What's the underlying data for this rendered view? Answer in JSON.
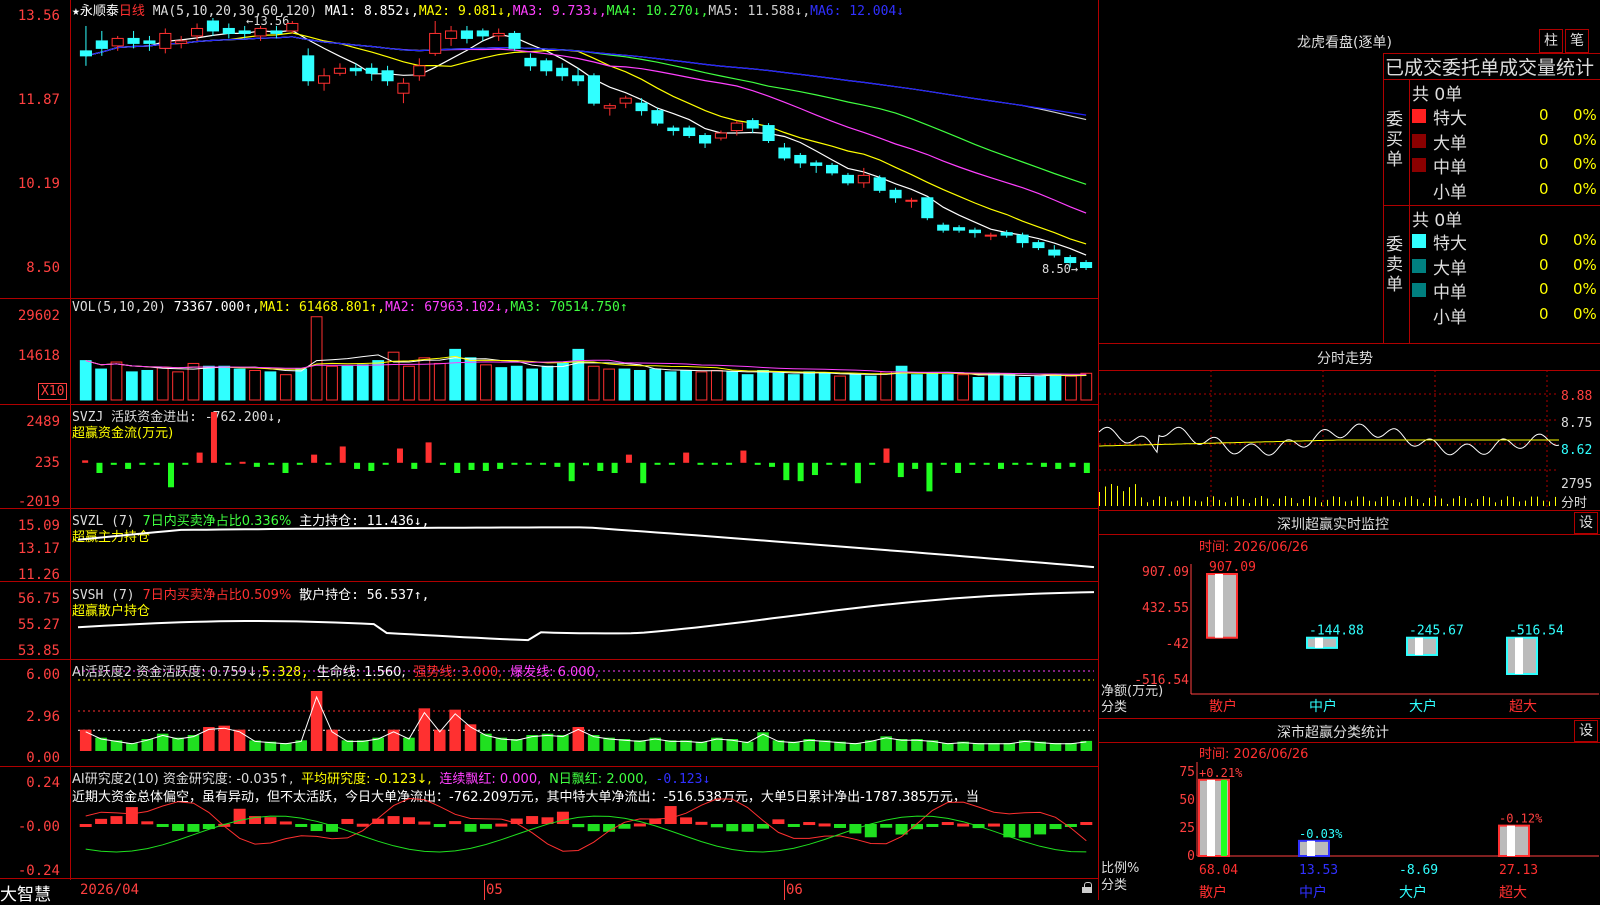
{
  "colors": {
    "up": "#ff3030",
    "down": "#30ffff",
    "ma1": "#ffffff",
    "ma2": "#ffff00",
    "ma3": "#ff40ff",
    "ma4": "#40ff40",
    "ma5": "#d0d0d0",
    "ma6": "#2020ff",
    "grid": "#b00000"
  },
  "price": {
    "stock_name": "永顺泰",
    "period": "日线",
    "params": "MA(5,10,20,30,60,120)",
    "ma1": "MA1: 8.852↓,",
    "ma2": "MA2: 9.081↓,",
    "ma3": "MA3: 9.733↓,",
    "ma4": "MA4: 10.270↓,",
    "ma5": "MA5: 11.588↓,",
    "ma6": "MA6: 12.004↓",
    "high_label": "13.56",
    "low_label": "8.50",
    "axis": [
      "13.56",
      "11.87",
      "10.19",
      "8.50"
    ]
  },
  "vol": {
    "params": "VOL(5,10,20)",
    "value": "73367.000↑,",
    "ma1": "MA1: 61468.801↑,",
    "ma2": "MA2: 67963.102↓,",
    "ma3": "MA3: 70514.750↑",
    "axis": [
      "29602",
      "14618"
    ],
    "unit": "X10"
  },
  "svzj": {
    "title": "SVZJ  活跃资金进出: -762.200↓,",
    "sub": "超赢资金流(万元)",
    "axis": [
      "2489",
      "235",
      "-2019"
    ]
  },
  "svzl": {
    "title_a": "SVZL (7)",
    "title_b": "7日内买卖净占比0.336%",
    "title_c": "主力持仓: 11.436↓,",
    "sub": "超赢主力持仓",
    "axis": [
      "15.09",
      "13.17",
      "11.26"
    ]
  },
  "svsh": {
    "title_a": "SVSH (7)",
    "title_b": "7日内买卖净占比0.509%",
    "title_c": "散户持仓: 56.537↑,",
    "sub": "超赢散户持仓",
    "axis": [
      "56.75",
      "55.27",
      "53.85"
    ]
  },
  "ai1": {
    "t1": "AI活跃度2 资金活跃度: 0.759↓,",
    "t2": "5.328,",
    "t3": "生命线: 1.560,",
    "t4": "强势线: 3.000,",
    "t5": "爆发线: 6.000,",
    "axis": [
      "6.00",
      "2.96",
      "0.00"
    ]
  },
  "ai2": {
    "t1": "AI研究度2(10) 资金研究度: -0.035↑,",
    "t2": "平均研究度: -0.123↓,",
    "t3": "连续飘红: 0.000,",
    "t4": "N日飘红: 2.000,",
    "t5": "-0.123↓",
    "desc": "近期大资金总体偏空，虽有异动，但不太活跃，今日大单净流出：-762.209万元，其中特大单净流出：-516.538万元，大单5日累计净出-1787.385万元，当",
    "axis": [
      "0.24",
      "-0.00",
      "-0.24"
    ]
  },
  "xaxis": {
    "d1": "2026/04",
    "d2": "05",
    "d3": "06"
  },
  "app_logo": "大智慧",
  "right": {
    "title": "龙虎看盘(逐单)",
    "btn_zhu": "柱",
    "btn_bi": "笔",
    "tab_title": "已成交委托单成交量统计",
    "buy_vert": "委买单",
    "sell_vert": "委卖单",
    "buy_total": "共 0单",
    "sell_total": "共 0单",
    "rows": [
      {
        "name": "特大",
        "v": "0",
        "p": "0%"
      },
      {
        "name": "大单",
        "v": "0",
        "p": "0%"
      },
      {
        "name": "中单",
        "v": "0",
        "p": "0%"
      },
      {
        "name": "小单",
        "v": "0",
        "p": "0%"
      }
    ],
    "fenshi": "分时走势",
    "fs_axis": [
      "8.88",
      "8.75",
      "8.62"
    ],
    "fs_vol": "2795",
    "fs_label": "分时",
    "monitor_title": "深圳超赢实时监控",
    "monitor_set": "设",
    "monitor_time": "时间: 2026/06/26",
    "monitor_axis": [
      "907.09",
      "432.55",
      "-42",
      "-516.54"
    ],
    "monitor_ylabel": "净额(万元)",
    "monitor_xlabel": "分类",
    "monitor_bars": [
      {
        "name": "散户",
        "value": 907.09,
        "label": "907.09"
      },
      {
        "name": "中户",
        "value": -144.88,
        "label": "-144.88"
      },
      {
        "name": "大户",
        "value": -245.67,
        "label": "-245.67"
      },
      {
        "name": "超大",
        "value": -516.54,
        "label": "-516.54"
      }
    ],
    "stat_title": "深市超赢分类统计",
    "stat_set": "设",
    "stat_time": "时间: 2026/06/26",
    "stat_axis": [
      "75",
      "50",
      "25",
      "0"
    ],
    "stat_ylabel": "比例%",
    "stat_xlabel": "分类",
    "stat_bars": [
      {
        "name": "散户",
        "value": 68.04,
        "label": "68.04",
        "top": "+0.21%"
      },
      {
        "name": "中户",
        "value": 13.53,
        "label": "13.53",
        "top": "-0.03%"
      },
      {
        "name": "大户",
        "value": -8.69,
        "label": "-8.69",
        "top": ""
      },
      {
        "name": "超大",
        "value": 27.13,
        "label": "27.13",
        "top": "-0.12%"
      }
    ]
  },
  "chart_data": [
    {
      "type": "candlestick",
      "title": "永顺泰 日线",
      "ylim": [
        8.5,
        13.56
      ],
      "ohlc": [
        [
          12.9,
          12.8,
          13.4,
          12.6
        ],
        [
          13.1,
          12.95,
          13.3,
          12.8
        ],
        [
          13.0,
          13.15,
          13.2,
          12.9
        ],
        [
          13.15,
          13.05,
          13.3,
          12.95
        ],
        [
          13.1,
          13.05,
          13.2,
          12.9
        ],
        [
          12.95,
          13.25,
          13.35,
          12.85
        ],
        [
          13.05,
          13.1,
          13.2,
          12.95
        ],
        [
          13.2,
          13.35,
          13.45,
          13.1
        ],
        [
          13.5,
          13.3,
          13.56,
          13.2
        ],
        [
          13.35,
          13.25,
          13.45,
          13.15
        ],
        [
          13.3,
          13.25,
          13.4,
          13.15
        ],
        [
          13.2,
          13.35,
          13.4,
          13.1
        ],
        [
          13.3,
          13.25,
          13.4,
          13.15
        ],
        [
          13.3,
          13.45,
          13.5,
          13.25
        ],
        [
          12.8,
          12.3,
          12.95,
          12.2
        ],
        [
          12.25,
          12.4,
          12.55,
          12.1
        ],
        [
          12.45,
          12.55,
          12.65,
          12.4
        ],
        [
          12.55,
          12.5,
          12.65,
          12.4
        ],
        [
          12.55,
          12.45,
          12.65,
          12.3
        ],
        [
          12.5,
          12.3,
          12.6,
          12.2
        ],
        [
          12.05,
          12.25,
          12.35,
          11.85
        ],
        [
          12.4,
          12.6,
          12.75,
          12.3
        ],
        [
          12.85,
          13.25,
          13.5,
          12.8
        ],
        [
          13.15,
          13.3,
          13.4,
          13.0
        ],
        [
          13.3,
          13.15,
          13.4,
          13.05
        ],
        [
          13.3,
          13.2,
          13.35,
          13.1
        ],
        [
          13.2,
          13.25,
          13.35,
          13.1
        ],
        [
          13.25,
          12.95,
          13.3,
          12.9
        ],
        [
          12.75,
          12.6,
          12.85,
          12.5
        ],
        [
          12.7,
          12.5,
          12.75,
          12.4
        ],
        [
          12.55,
          12.4,
          12.65,
          12.3
        ],
        [
          12.4,
          12.3,
          12.55,
          12.2
        ],
        [
          12.4,
          11.85,
          12.45,
          11.8
        ],
        [
          11.75,
          11.8,
          11.85,
          11.6
        ],
        [
          11.85,
          11.95,
          12.0,
          11.75
        ],
        [
          11.85,
          11.7,
          11.95,
          11.6
        ],
        [
          11.7,
          11.45,
          11.75,
          11.4
        ],
        [
          11.35,
          11.3,
          11.4,
          11.2
        ],
        [
          11.35,
          11.2,
          11.4,
          11.15
        ],
        [
          11.2,
          11.05,
          11.25,
          10.95
        ],
        [
          11.15,
          11.25,
          11.3,
          11.1
        ],
        [
          11.3,
          11.45,
          11.5,
          11.2
        ],
        [
          11.5,
          11.35,
          11.55,
          11.25
        ],
        [
          11.4,
          11.1,
          11.45,
          11.05
        ],
        [
          10.95,
          10.75,
          11.05,
          10.7
        ],
        [
          10.8,
          10.65,
          10.85,
          10.55
        ],
        [
          10.65,
          10.6,
          10.7,
          10.45
        ],
        [
          10.6,
          10.45,
          10.65,
          10.4
        ],
        [
          10.4,
          10.25,
          10.45,
          10.2
        ],
        [
          10.25,
          10.4,
          10.55,
          10.15
        ],
        [
          10.35,
          10.1,
          10.4,
          10.05
        ],
        [
          10.1,
          9.95,
          10.15,
          9.85
        ],
        [
          9.9,
          9.9,
          9.95,
          9.75
        ],
        [
          9.95,
          9.55,
          9.95,
          9.5
        ],
        [
          9.4,
          9.3,
          9.45,
          9.25
        ],
        [
          9.35,
          9.3,
          9.4,
          9.25
        ],
        [
          9.3,
          9.25,
          9.35,
          9.15
        ],
        [
          9.2,
          9.2,
          9.25,
          9.1
        ],
        [
          9.25,
          9.2,
          9.3,
          9.15
        ],
        [
          9.2,
          9.05,
          9.25,
          8.95
        ],
        [
          9.05,
          8.95,
          9.1,
          8.9
        ],
        [
          8.9,
          8.8,
          9.0,
          8.75
        ],
        [
          8.75,
          8.65,
          8.8,
          8.55
        ],
        [
          8.65,
          8.55,
          8.7,
          8.5
        ]
      ]
    },
    {
      "type": "bar",
      "title": "VOL(5,10,20)",
      "ylim": [
        0,
        32000
      ],
      "values": [
        14000,
        11000,
        13500,
        10000,
        10500,
        11500,
        10000,
        13000,
        12000,
        12000,
        11000,
        10500,
        10000,
        9000,
        11000,
        29602,
        12000,
        12000,
        12500,
        14000,
        17000,
        12000,
        15000,
        13000,
        18000,
        15000,
        12500,
        11500,
        12000,
        11000,
        12000,
        13000,
        18000,
        12000,
        11000,
        11000,
        10500,
        11000,
        10000,
        10500,
        10000,
        10500,
        10000,
        9000,
        10500,
        9500,
        9000,
        10000,
        9500,
        8500,
        9000,
        8500,
        10000,
        12000,
        9000,
        9500,
        9000,
        9000,
        8000,
        9500,
        9000,
        8000,
        8500,
        9000,
        8500,
        9500
      ]
    },
    {
      "type": "bar",
      "title": "SVZJ",
      "ylim": [
        -2019,
        2489
      ],
      "values": [
        120,
        -500,
        -100,
        -300,
        -80,
        -100,
        -1200,
        -60,
        500,
        2489,
        -40,
        50,
        -200,
        -60,
        -500,
        -50,
        400,
        -80,
        800,
        -300,
        -400,
        -60,
        700,
        -300,
        1000,
        -100,
        -500,
        -350,
        -400,
        -300,
        -80,
        -60,
        -50,
        -200,
        -900,
        -120,
        -400,
        -500,
        400,
        -1000,
        -60,
        -50,
        500,
        -60,
        -40,
        -80,
        600,
        -100,
        -200,
        -850,
        -900,
        -600,
        -50,
        -120,
        -1000,
        -80,
        700,
        -700,
        -300,
        -1400,
        -60,
        -500,
        -80,
        -80,
        -300,
        -100,
        -40,
        -200,
        -300,
        -200,
        -500
      ]
    },
    {
      "type": "bar",
      "title": "AI活跃度2",
      "ylim": [
        0,
        6
      ],
      "values": [
        1.6,
        1.0,
        0.8,
        0.6,
        0.9,
        1.3,
        1.0,
        1.2,
        1.8,
        1.9,
        1.6,
        0.8,
        0.7,
        0.6,
        0.8,
        4.5,
        1.6,
        0.8,
        0.8,
        1.0,
        1.6,
        1.0,
        3.2,
        1.6,
        3.1,
        2.0,
        1.3,
        1.0,
        0.9,
        1.2,
        1.3,
        1.2,
        1.8,
        1.2,
        1.0,
        0.9,
        0.8,
        1.0,
        0.8,
        0.8,
        0.7,
        1.0,
        0.9,
        0.7,
        1.4,
        0.8,
        0.7,
        0.9,
        0.8,
        0.7,
        0.6,
        0.8,
        1.1,
        0.9,
        0.9,
        0.8,
        0.6,
        0.7,
        0.6,
        0.6,
        0.6,
        0.8,
        0.7,
        0.6,
        0.6,
        0.759
      ]
    }
  ]
}
